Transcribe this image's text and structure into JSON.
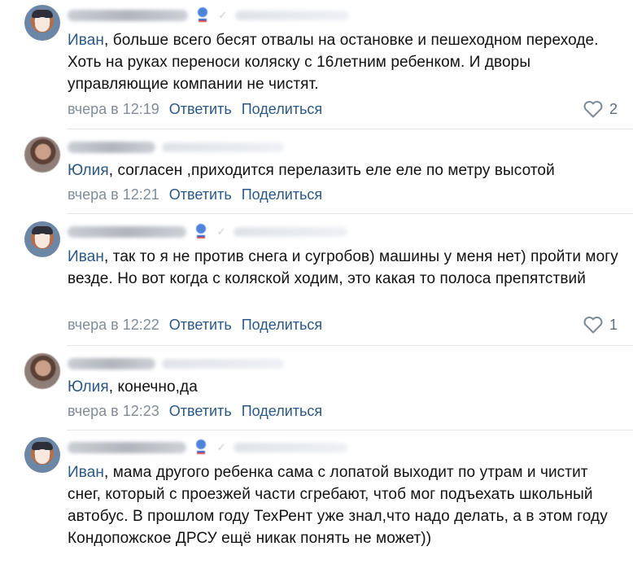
{
  "comments": [
    {
      "reply_to_name": "Иван",
      "text": ", больше всего бесят отвалы на остановке и пешеходном переходе. Хоть на руках переноси коляску с 16летним ребенком. И дворы управляющие компании не чистят.",
      "time": "вчера в 12:19",
      "reply_label": "Ответить",
      "share_label": "Поделиться",
      "likes": "2"
    },
    {
      "reply_to_name": "Юлия",
      "text": ", согласен ,приходится перелазить еле еле по метру высотой",
      "time": "вчера в 12:21",
      "reply_label": "Ответить",
      "share_label": "Поделиться"
    },
    {
      "reply_to_name": "Иван",
      "text": ", так то я не против снега и сугробов) машины у меня нет) пройти могу везде. Но вот когда с коляской ходим, это какая то полоса препятствий",
      "time": "вчера в 12:22",
      "reply_label": "Ответить",
      "share_label": "Поделиться",
      "likes": "1"
    },
    {
      "reply_to_name": "Юлия",
      "text": ", конечно,да",
      "time": "вчера в 12:23",
      "reply_label": "Ответить",
      "share_label": "Поделиться"
    },
    {
      "reply_to_name": "Иван",
      "text": ", мама другого ребенка сама с лопатой выходит по утрам и чистит снег, который с проезжей части сгребают, чтоб мог подъехать школьный автобус. В прошлом году ТехРент уже знал,что надо делать, а в этом году Кондопожское ДРСУ ещё никак понять не может))"
    }
  ],
  "icons": {
    "like": "heart-icon",
    "author_badge": "flag-icon",
    "reply_arrow": "check-icon"
  },
  "colors": {
    "link": "#2a5885",
    "meta": "#818c99",
    "divider": "#e7e8ec"
  }
}
